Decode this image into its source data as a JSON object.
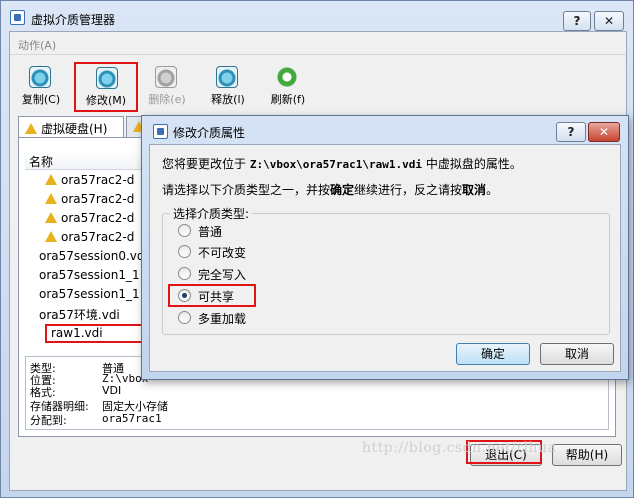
{
  "window": {
    "title": "虚拟介质管理器",
    "help_btn": "?",
    "close_btn": "✕"
  },
  "menu": {
    "action": "动作(A)"
  },
  "toolbar": {
    "copy": "复制(C)",
    "modify": "修改(M)",
    "delete": "删除(e)",
    "release": "释放(l)",
    "refresh": "刷新(f)"
  },
  "tabs": {
    "virtual_disks": "虚拟硬盘(H)"
  },
  "list": {
    "header": "名称",
    "rows": [
      {
        "label": "ora57rac2-d",
        "warning": true
      },
      {
        "label": "ora57rac2-d",
        "warning": true
      },
      {
        "label": "ora57rac2-d",
        "warning": true
      },
      {
        "label": "ora57rac2-d",
        "warning": true
      },
      {
        "label": "ora57session0.vd",
        "warning": false
      },
      {
        "label": "ora57session1_1",
        "warning": false
      },
      {
        "label": "ora57session1_1",
        "warning": false
      },
      {
        "label": "ora57环境.vdi",
        "warning": false
      },
      {
        "label": "raw1.vdi",
        "warning": false
      }
    ]
  },
  "details": {
    "type_label": "类型:",
    "type_value": "普通",
    "location_label": "位置:",
    "location_value": "Z:\\vbox",
    "format_label": "格式:",
    "format_value": "VDI",
    "storage_label": "存储器明细:",
    "storage_value": "固定大小存储",
    "attached_label": "分配到:",
    "attached_value": "ora57rac1"
  },
  "buttons": {
    "exit": "退出(C)",
    "help": "帮助(H)"
  },
  "watermark": "http://blog.csdn.net/rlhua",
  "dialog": {
    "title": "修改介质属性",
    "help_btn": "?",
    "close_btn": "✕",
    "msg_prefix": "您将要更改位于 ",
    "msg_path": "Z:\\vbox\\ora57rac1\\raw1.vdi",
    "msg_suffix": " 中虚拟盘的属性。",
    "instruction_a": "请选择以下介质类型之一，并按",
    "instruction_ok": "确定",
    "instruction_b": "继续进行，反之请按",
    "instruction_cancel": "取消",
    "instruction_c": "。",
    "group_label": "选择介质类型:",
    "options": [
      {
        "label": "普通",
        "checked": false
      },
      {
        "label": "不可改变",
        "checked": false
      },
      {
        "label": "完全写入",
        "checked": false
      },
      {
        "label": "可共享",
        "checked": true
      },
      {
        "label": "多重加载",
        "checked": false
      }
    ],
    "ok": "确定",
    "cancel": "取消"
  }
}
